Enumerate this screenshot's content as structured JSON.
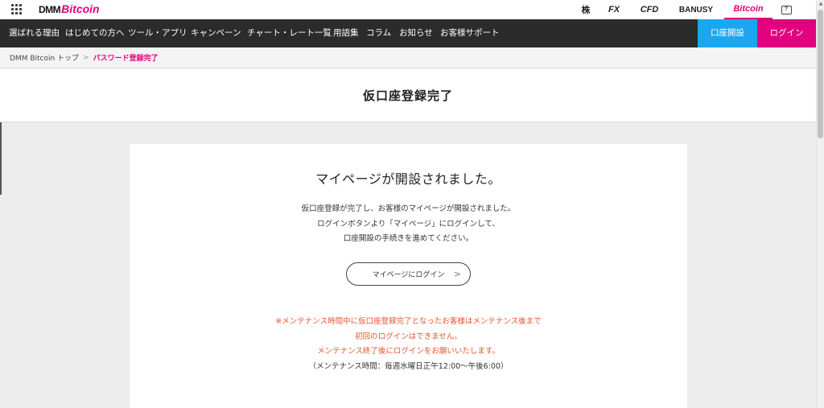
{
  "header": {
    "logo_dmm": "DMM",
    "logo_bitcoin": "Bitcoin",
    "products": [
      {
        "label": "株"
      },
      {
        "label": "FX"
      },
      {
        "label": "CFD"
      },
      {
        "label": "BANUSY"
      },
      {
        "label": "Bitcoin",
        "active": true
      }
    ],
    "help_icon": "?"
  },
  "nav": {
    "items": [
      "選ばれる理由",
      "はじめての方へ",
      "ツール・アプリ",
      "キャンペーン",
      "チャート・レート一覧",
      "用語集",
      "コラム",
      "お知らせ",
      "お客様サポート"
    ],
    "open_account": "口座開設",
    "login": "ログイン"
  },
  "breadcrumb": {
    "home": "DMM Bitcoin トップ",
    "separator": ">",
    "current": "パスワード登録完了"
  },
  "page": {
    "title": "仮口座登録完了"
  },
  "card": {
    "heading": "マイページが開設されました。",
    "description": [
      "仮口座登録が完了し、お客様のマイページが開設されました。",
      "ログインボタンより「マイページ」にログインして、",
      "口座開設の手続きを進めてください。"
    ],
    "button_label": "マイページにログイン",
    "button_chevron": ">",
    "notice": [
      "※メンテナンス時間中に仮口座登録完了となったお客様はメンテナンス後まで",
      "初回のログインはできません。",
      "メンテナンス終了後にログインをお願いいたします。"
    ],
    "maintenance_hours": "（メンテナンス時間：毎週水曜日正午12:00～午後6:00）"
  },
  "colors": {
    "brand_pink": "#e3007f",
    "open_blue": "#1da6f0",
    "nav_dark": "#2b2b2b",
    "notice_orange": "#e8532b"
  }
}
